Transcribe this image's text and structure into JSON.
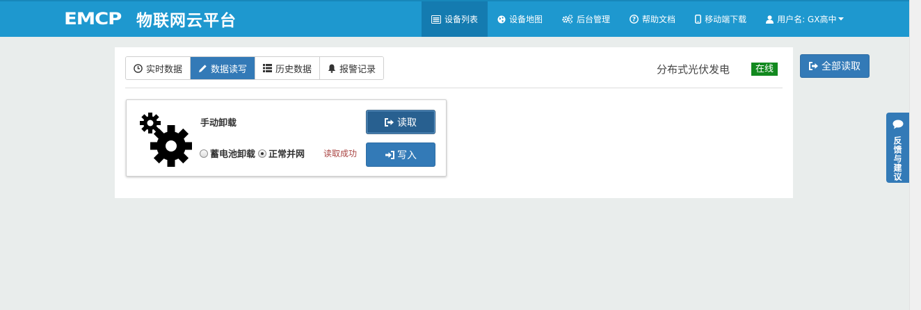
{
  "header": {
    "logo_text": "EMCP",
    "brand_name": "物联网云平台",
    "nav": [
      {
        "label": "设备列表",
        "icon": "list-icon",
        "active": true
      },
      {
        "label": "设备地图",
        "icon": "globe-icon",
        "active": false
      },
      {
        "label": "后台管理",
        "icon": "cogs-icon",
        "active": false
      },
      {
        "label": "帮助文档",
        "icon": "question-icon",
        "active": false
      },
      {
        "label": "移动端下载",
        "icon": "mobile-icon",
        "active": false
      },
      {
        "label": "用户名: GX高中",
        "icon": "user-icon",
        "active": false,
        "has_dropdown": true
      }
    ]
  },
  "tabs": [
    {
      "label": "实时数据",
      "icon": "clock-icon",
      "active": false
    },
    {
      "label": "数据读写",
      "icon": "pencil-icon",
      "active": true
    },
    {
      "label": "历史数据",
      "icon": "list-icon",
      "active": false
    },
    {
      "label": "报警记录",
      "icon": "bell-icon",
      "active": false
    }
  ],
  "device": {
    "name": "分布式光伏发电",
    "status": "在线",
    "status_color": "#12891f"
  },
  "read_all_label": "全部读取",
  "card": {
    "title": "手动卸载",
    "options": [
      {
        "label": "蓄电池卸载",
        "checked": false
      },
      {
        "label": "正常并网",
        "checked": true
      }
    ],
    "status_text": "读取成功",
    "read_label": "读取",
    "write_label": "写入"
  },
  "feedback_label": "反馈与建议",
  "colors": {
    "header": "#1e98cf",
    "header_active": "#147bb0",
    "primary": "#337ab7",
    "primary_dark": "#286090",
    "success_text": "#a94442"
  }
}
